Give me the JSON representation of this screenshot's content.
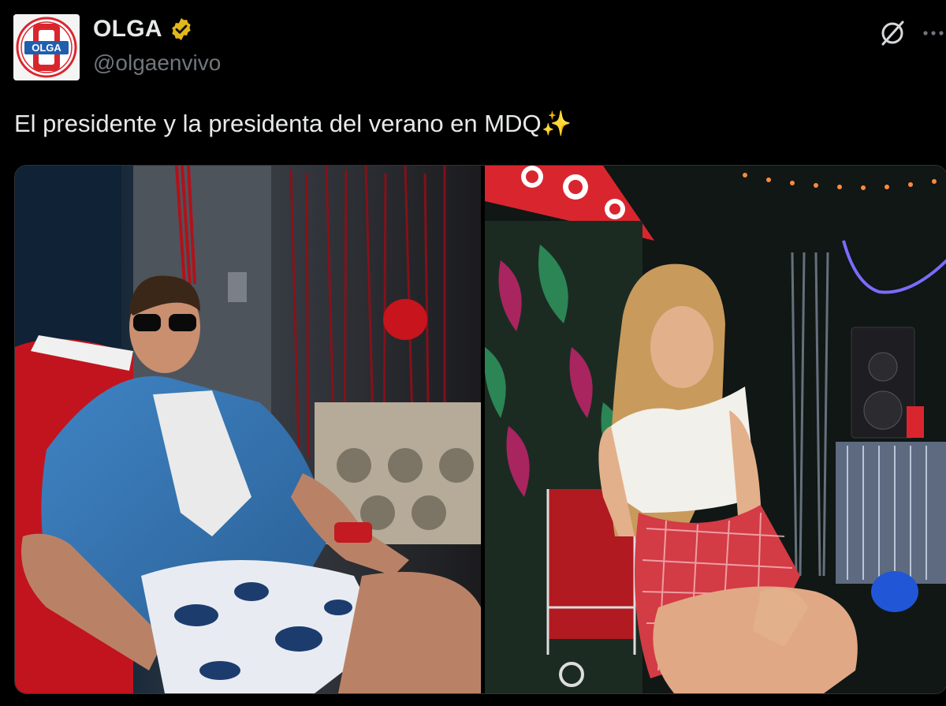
{
  "tweet": {
    "author": {
      "display_name": "OLGA",
      "handle": "@olgaenvivo",
      "verified": true,
      "avatar_label": "OLGA"
    },
    "text": "El presidente y la presidenta del verano en MDQ",
    "text_emoji": "✨",
    "media": [
      {
        "icon": "photo-man-sunglasses"
      },
      {
        "icon": "photo-woman-party"
      }
    ]
  },
  "icons": {
    "verified": "verified-badge-icon",
    "grok": "grok-icon",
    "more": "more-options-icon"
  },
  "colors": {
    "background": "#000000",
    "text": "#e7e9ea",
    "muted": "#71767b",
    "verified_gold": "#e2b719",
    "brand_red": "#d9262e",
    "brand_blue": "#1f5fae"
  }
}
